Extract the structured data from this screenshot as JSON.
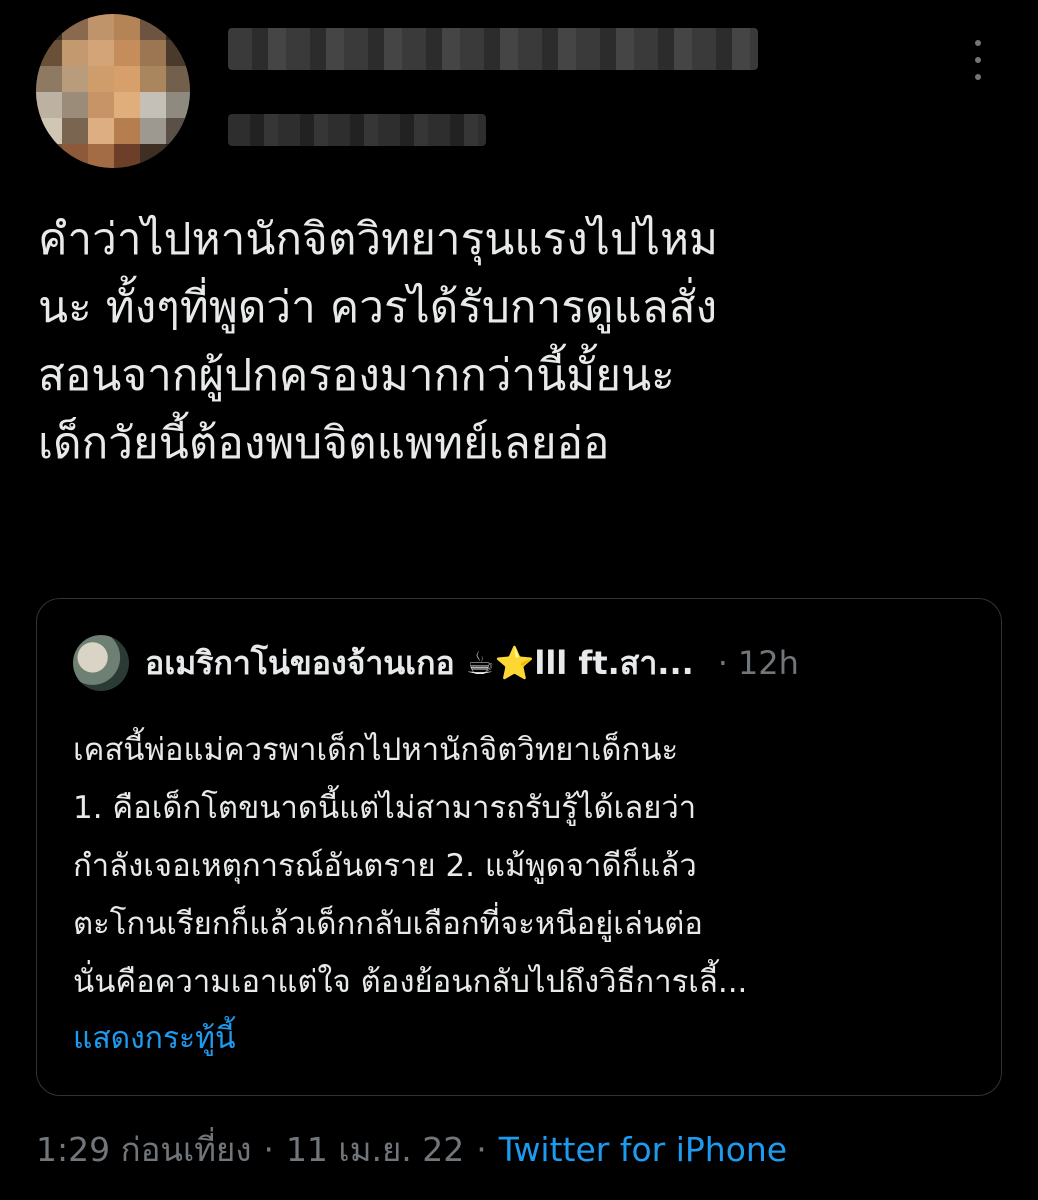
{
  "header": {
    "author_name_blurred": "",
    "author_handle_blurred": "",
    "more_icon": "more-vertical-icon"
  },
  "tweet": {
    "text": "คำว่าไปหานักจิตวิทยารุนแรงไปไหม\nนะ ทั้งๆที่พูดว่า ควรได้รับการดูแลสั่ง\nสอนจากผู้ปกครองมากกว่านี้มั้ยนะ\nเด็กวัยนี้ต้องพบจิตแพทย์เลยอ่อ"
  },
  "quote": {
    "author_name": "อเมริกาโน่ของจ้านเกอ ☕⭐lll ft.สา...",
    "separator": "·",
    "time": "12h",
    "text": "เคสนี้พ่อแม่ควรพาเด็กไปหานักจิตวิทยาเด็กนะ\n1. คือเด็กโตขนาดนี้แต่ไม่สามารถรับรู้ได้เลยว่า\nกำลังเจอเหตุการณ์อันตราย 2. แม้พูดจาดีก็แล้ว\nตะโกนเรียกก็แล้วเด็กกลับเลือกที่จะหนีอยู่เล่นต่อ\nนั่นคือความเอาแต่ใจ ต้องย้อนกลับไปถึงวิธีการเลี้...",
    "show_thread": "แสดงกระทู้นี้"
  },
  "meta": {
    "time": "1:29 ก่อนเที่ยง",
    "sep1": "·",
    "date": "11 เม.ย. 22",
    "sep2": "·",
    "source": "Twitter for iPhone"
  },
  "colors": {
    "background": "#000000",
    "text": "#e7e9ea",
    "secondary": "#71767b",
    "link": "#1d9bf0",
    "border": "#2f3336"
  }
}
